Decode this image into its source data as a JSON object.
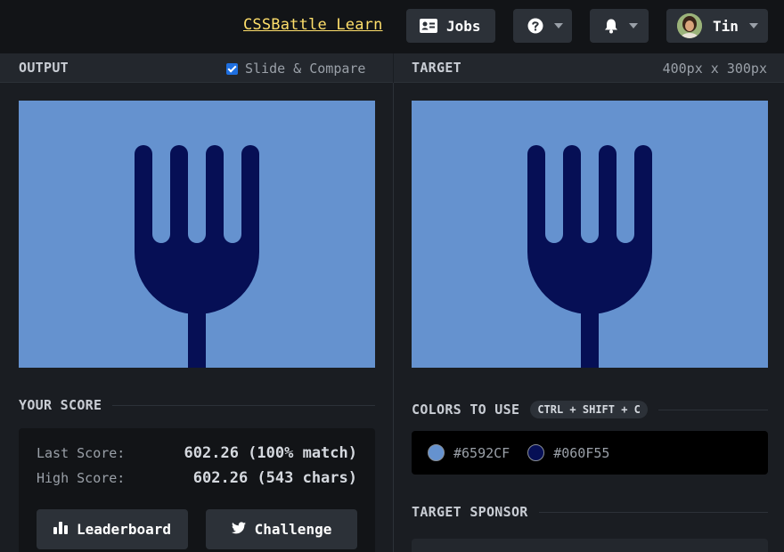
{
  "topbar": {
    "learn_link": "CSSBattle Learn",
    "jobs_label": "Jobs",
    "user_name": "Tin"
  },
  "output_panel": {
    "title": "OUTPUT",
    "slide_compare_label": "Slide & Compare",
    "slide_compare_checked": true
  },
  "target_panel": {
    "title": "TARGET",
    "dimensions": "400px x 300px"
  },
  "score": {
    "title": "YOUR SCORE",
    "last_score_label": "Last Score:",
    "last_score_value": "602.26 (100% match)",
    "high_score_label": "High Score:",
    "high_score_value": "602.26 (543 chars)",
    "leaderboard_label": "Leaderboard",
    "challenge_label": "Challenge"
  },
  "colors": {
    "title": "COLORS TO USE",
    "shortcut": "CTRL + SHIFT + C",
    "items": [
      {
        "hex": "#6592CF",
        "color": "#6592cf"
      },
      {
        "hex": "#060F55",
        "color": "#060f55"
      }
    ]
  },
  "sponsor": {
    "title": "TARGET SPONSOR"
  },
  "theme": {
    "background": "#1a1d22",
    "accent_link": "#ffdf6b",
    "canvas_bg": "#6592cf",
    "fork_color": "#060f55"
  }
}
